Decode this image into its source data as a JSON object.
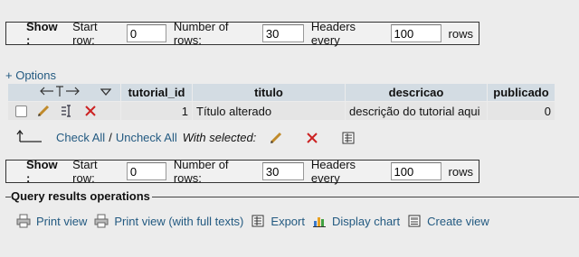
{
  "nav_top": {
    "show_label": "Show :",
    "start_row_label": "Start row:",
    "start_row_value": "0",
    "num_rows_label": "Number of rows:",
    "num_rows_value": "30",
    "headers_every_label": "Headers every",
    "headers_every_value": "100",
    "rows_label": "rows"
  },
  "nav_bottom": {
    "show_label": "Show :",
    "start_row_label": "Start row:",
    "start_row_value": "0",
    "num_rows_label": "Number of rows:",
    "num_rows_value": "30",
    "headers_every_label": "Headers every",
    "headers_every_value": "100",
    "rows_label": "rows"
  },
  "options_label": "+ Options",
  "table": {
    "columns": [
      "tutorial_id",
      "titulo",
      "descricao",
      "publicado"
    ],
    "rows": [
      {
        "tutorial_id": "1",
        "titulo": "Título alterado",
        "descricao": "descrição do tutorial aqui",
        "publicado": "0"
      }
    ]
  },
  "bulk": {
    "check_all": "Check All",
    "separator": "/",
    "uncheck_all": "Uncheck All",
    "with_selected": "With selected:"
  },
  "query_ops": {
    "legend": "Query results operations",
    "items": [
      {
        "label": "Print view",
        "icon": "printer-icon"
      },
      {
        "label": "Print view (with full texts)",
        "icon": "printer-icon"
      },
      {
        "label": "Export",
        "icon": "export-icon"
      },
      {
        "label": "Display chart",
        "icon": "chart-icon"
      },
      {
        "label": "Create view",
        "icon": "view-icon"
      }
    ]
  },
  "colors": {
    "link": "#235a81",
    "header_bg": "#d3dce3",
    "row_bg": "#e5e5e5",
    "delete_red": "#cc2222"
  }
}
